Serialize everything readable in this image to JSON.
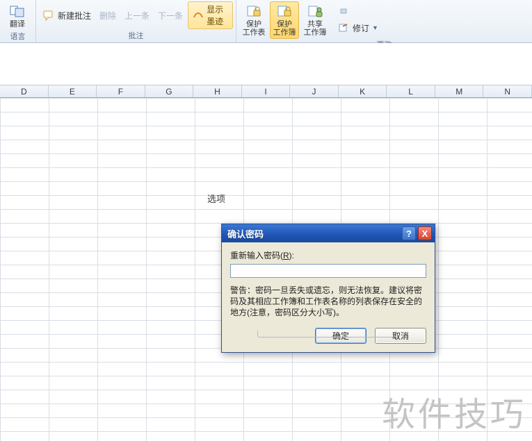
{
  "ribbon": {
    "group_language": {
      "label": "语言",
      "translate": "翻译"
    },
    "group_comments": {
      "label": "批注",
      "new_comment": "新建批注",
      "delete": "删除",
      "prev": "上一条",
      "next": "下一条",
      "show_ink": "显示墨迹"
    },
    "group_changes": {
      "label": "更改",
      "protect_sheet_l1": "保护",
      "protect_sheet_l2": "工作表",
      "protect_book_l1": "保护",
      "protect_book_l2": "工作簿",
      "share_book_l1": "共享",
      "share_book_l2": "工作簿",
      "revisions": "修订"
    }
  },
  "columns": [
    "D",
    "E",
    "F",
    "G",
    "H",
    "I",
    "J",
    "K",
    "L",
    "M",
    "N"
  ],
  "background_label": "选项",
  "dialog": {
    "title": "确认密码",
    "label_prefix": "重新输入密码(",
    "label_key": "R",
    "label_suffix": "):",
    "password_value": "",
    "warning": "警告：密码一旦丢失或遗忘，则无法恢复。建议将密码及其相应工作簿和工作表名称的列表保存在安全的地方(注意，密码区分大小写)。",
    "ok": "确定",
    "cancel": "取消",
    "help_tooltip": "?",
    "close_tooltip": "X"
  },
  "watermark": "软件技巧"
}
